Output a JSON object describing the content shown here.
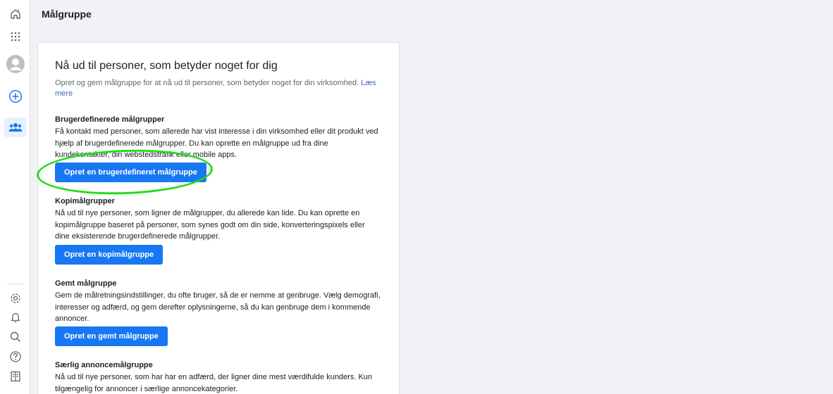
{
  "sidebar": {
    "top_icons": [
      "home-icon",
      "apps-grid-icon",
      "avatar",
      "add-circle-icon",
      "audiences-icon"
    ],
    "bottom_icons": [
      "settings-gear-icon",
      "notifications-bell-icon",
      "search-icon",
      "help-icon",
      "report-icon"
    ],
    "accent": "#1877f2"
  },
  "header": {
    "title": "Målgruppe"
  },
  "card": {
    "heading": "Nå ud til personer, som betyder noget for dig",
    "description": "Opret og gem målgruppe for at nå ud til personer, som betyder noget for din virksomhed.",
    "learn_more": "Læs mere",
    "sections": [
      {
        "title": "Brugerdefinerede målgrupper",
        "body": "Få kontakt med personer, som allerede har vist interesse i din virksomhed eller dit produkt ved hjælp af brugerdefinerede målgrupper. Du kan oprette en målgruppe ud fra dine kundekontakter, din webstedstrafik eller mobile apps.",
        "button": "Opret en brugerdefineret målgruppe"
      },
      {
        "title": "Kopimålgrupper",
        "body": "Nå ud til nye personer, som ligner de målgrupper, du allerede kan lide. Du kan oprette en kopimålgruppe baseret på personer, som synes godt om din side, konverteringspixels eller dine eksisterende brugerdefinerede målgrupper.",
        "button": "Opret en kopimålgruppe"
      },
      {
        "title": "Gemt målgruppe",
        "body": "Gem de målretningsindstillinger, du ofte bruger, så de er nemme at genbruge. Vælg demografi, interesser og adfærd, og gem derefter oplysningerne, så du kan genbruge dem i kommende annoncer.",
        "button": "Opret en gemt målgruppe"
      },
      {
        "title": "Særlig annoncemålgruppe",
        "body": "Nå ud til nye personer, som har har en adfærd, der ligner dine mest værdifulde kunders. Kun tilgængelig for annoncer i særlige annoncekategorier."
      }
    ]
  },
  "colors": {
    "button_bg": "#1877f2",
    "highlight": "#22dd18"
  }
}
